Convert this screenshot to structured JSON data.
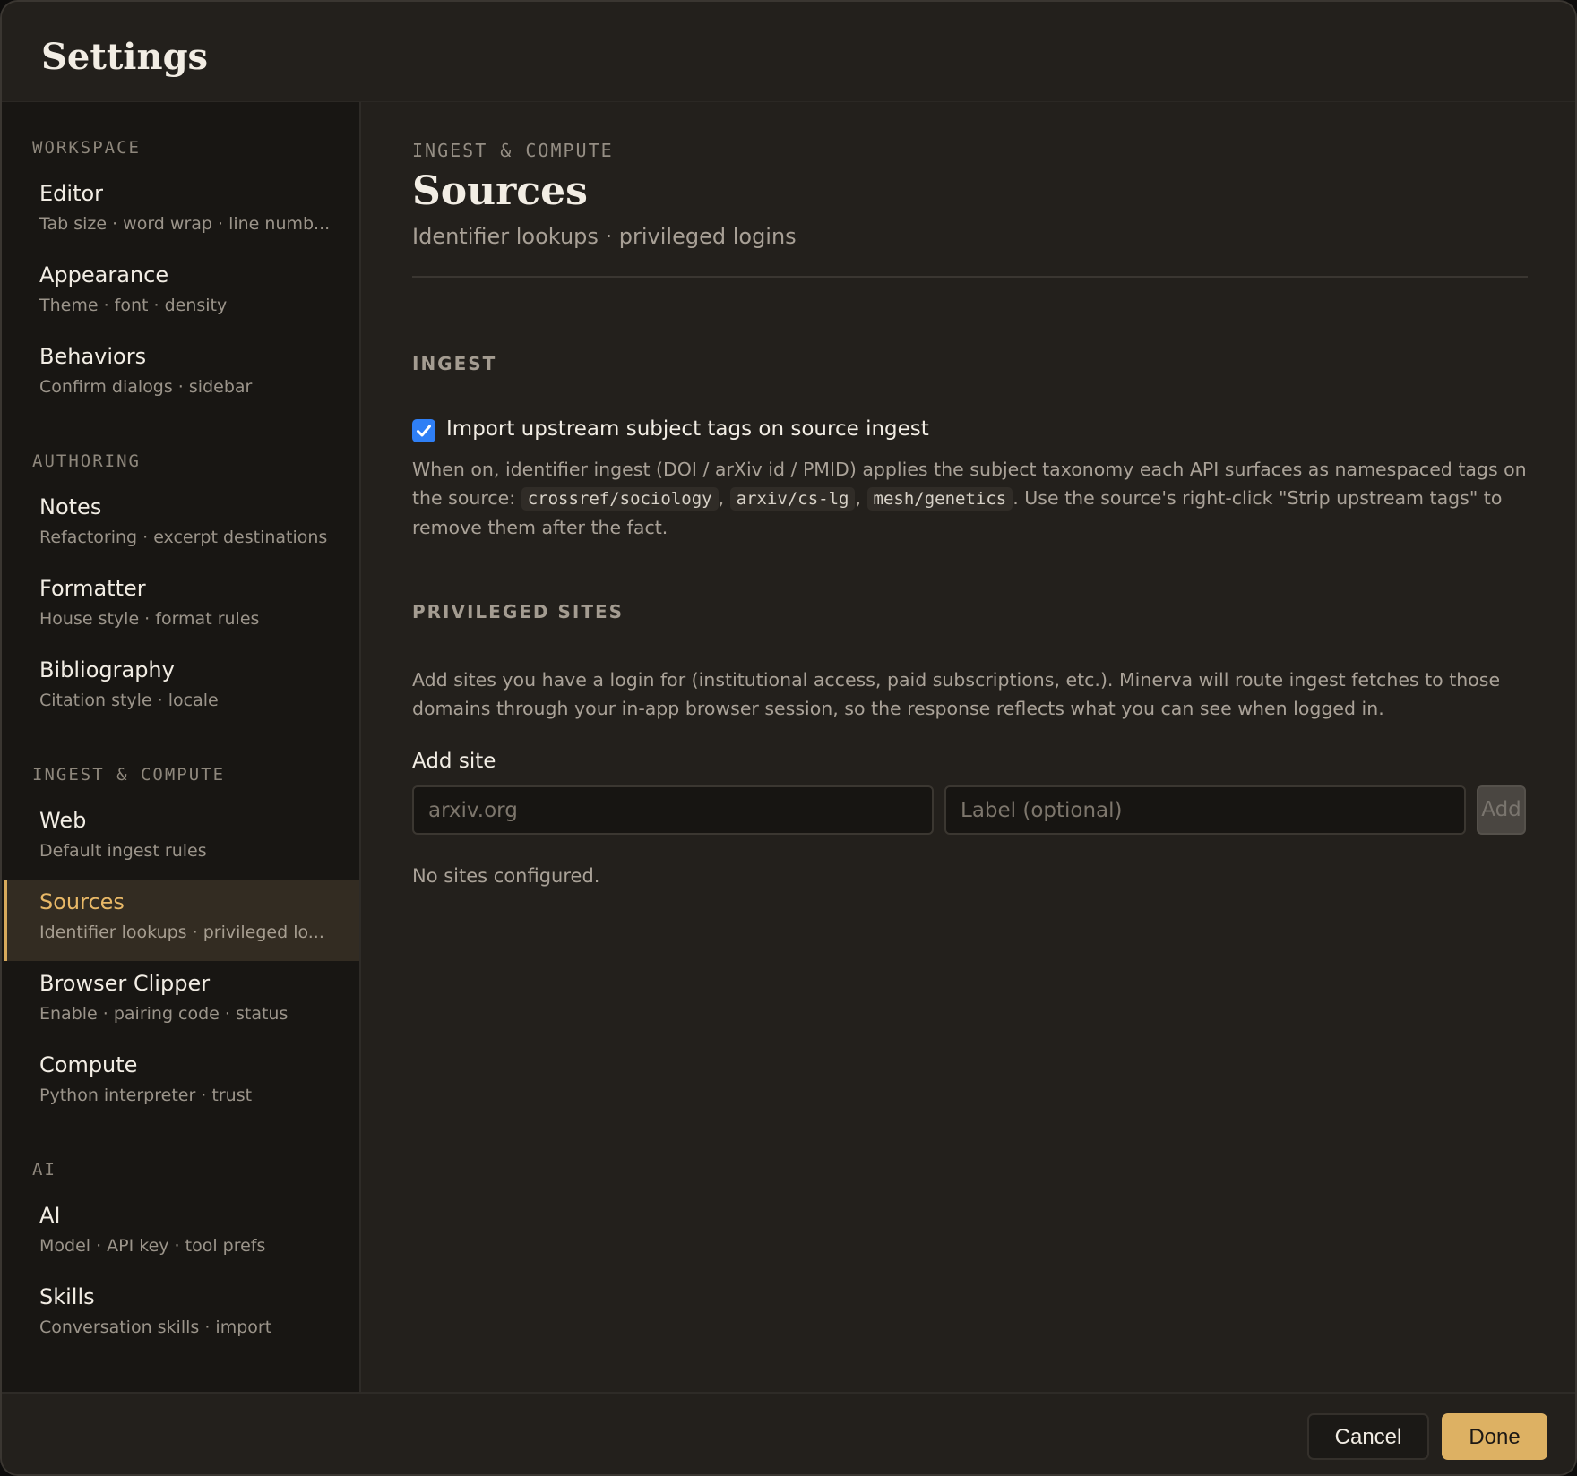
{
  "window": {
    "title": "Settings"
  },
  "sidebar": {
    "groups": [
      {
        "label": "WORKSPACE",
        "items": [
          {
            "title": "Editor",
            "subtitle": "Tab size · word wrap · line numb..."
          },
          {
            "title": "Appearance",
            "subtitle": "Theme · font · density"
          },
          {
            "title": "Behaviors",
            "subtitle": "Confirm dialogs · sidebar"
          }
        ]
      },
      {
        "label": "AUTHORING",
        "items": [
          {
            "title": "Notes",
            "subtitle": "Refactoring · excerpt destinations"
          },
          {
            "title": "Formatter",
            "subtitle": "House style · format rules"
          },
          {
            "title": "Bibliography",
            "subtitle": "Citation style · locale"
          }
        ]
      },
      {
        "label": "INGEST & COMPUTE",
        "items": [
          {
            "title": "Web",
            "subtitle": "Default ingest rules"
          },
          {
            "title": "Sources",
            "subtitle": "Identifier lookups · privileged lo..."
          },
          {
            "title": "Browser Clipper",
            "subtitle": "Enable · pairing code · status"
          },
          {
            "title": "Compute",
            "subtitle": "Python interpreter · trust"
          }
        ]
      },
      {
        "label": "AI",
        "items": [
          {
            "title": "AI",
            "subtitle": "Model · API key · tool prefs"
          },
          {
            "title": "Skills",
            "subtitle": "Conversation skills · import"
          }
        ]
      }
    ],
    "active": "Sources"
  },
  "main": {
    "eyebrow": "INGEST & COMPUTE",
    "title": "Sources",
    "subtitle": "Identifier lookups · privileged logins",
    "ingest": {
      "heading": "INGEST",
      "checkbox_label": "Import upstream subject tags on source ingest",
      "checked": true,
      "desc_before": "When on, identifier ingest (DOI / arXiv id / PMID) applies the subject taxonomy each API surfaces as namespaced tags on the source:",
      "tag1": "crossref/sociology",
      "tag2": "arxiv/cs-lg",
      "tag3": "mesh/genetics",
      "desc_after": ". Use the source's right-click \"Strip upstream tags\" to remove them after the fact."
    },
    "privileged": {
      "heading": "PRIVILEGED SITES",
      "desc": "Add sites you have a login for (institutional access, paid subscriptions, etc.). Minerva will route ingest fetches to those domains through your in-app browser session, so the response reflects what you can see when logged in.",
      "add_label": "Add site",
      "site_placeholder": "arxiv.org",
      "label_placeholder": "Label (optional)",
      "add_button": "Add",
      "empty": "No sites configured."
    }
  },
  "footer": {
    "cancel": "Cancel",
    "done": "Done"
  },
  "colors": {
    "accent": "#ddb163",
    "checkbox": "#2f7ff5",
    "background": "#23201c",
    "sidebar": "#181613"
  }
}
